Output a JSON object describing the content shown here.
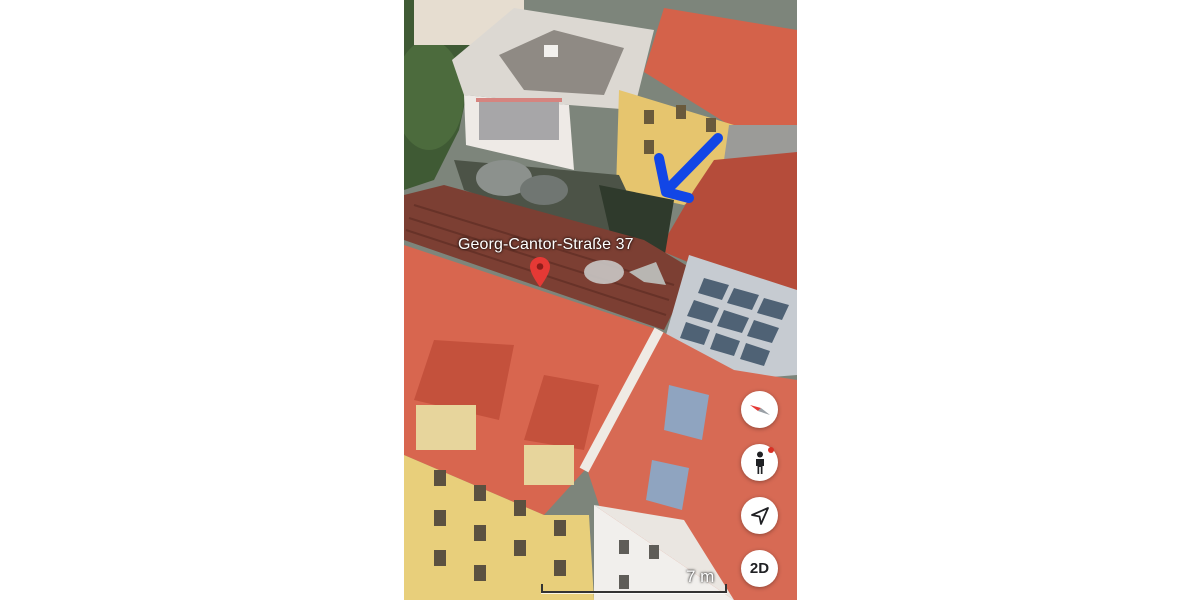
{
  "map": {
    "view_mode": "3D satellite",
    "address_label": "Georg-Cantor-Straße 37",
    "pin_color": "#e53935",
    "annotation_arrow_color": "#1246e6"
  },
  "controls": {
    "compass_icon": "compass-icon",
    "pegman_icon": "pegman-icon",
    "locate_icon": "navigation-arrow-icon",
    "toggle_2d_label": "2D"
  },
  "scale": {
    "label": "7 m"
  }
}
